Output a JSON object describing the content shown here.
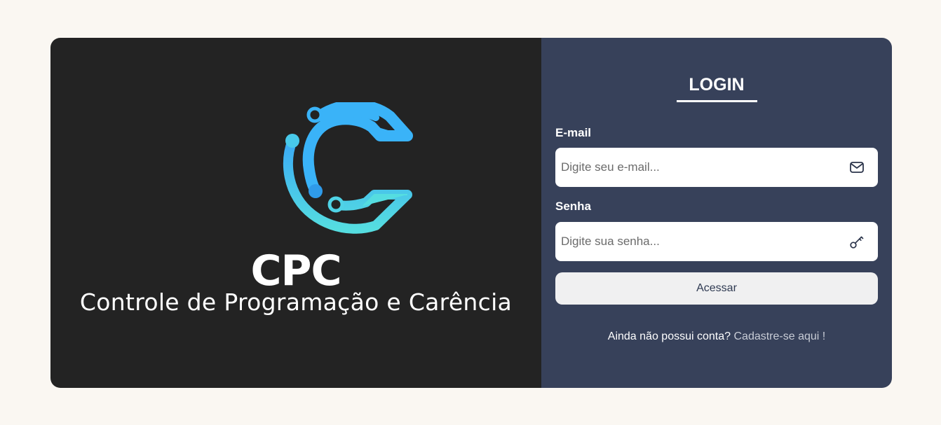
{
  "brand": {
    "acronym": "CPC",
    "subtitle": "Controle de Programação e Carência",
    "logo_icon": "cpc-circuit-c-logo",
    "colors": {
      "gradient_top": "#3aa9f5",
      "gradient_bottom": "#55dde0",
      "panel_background": "#232323"
    }
  },
  "login": {
    "title": "LOGIN",
    "email": {
      "label": "E-mail",
      "placeholder": "Digite seu e-mail...",
      "value": "",
      "icon": "envelope-icon"
    },
    "password": {
      "label": "Senha",
      "placeholder": "Digite sua senha...",
      "value": "",
      "icon": "key-icon"
    },
    "submit_label": "Acessar",
    "signup_prompt": "Ainda não possui conta?",
    "signup_link": "Cadastre-se aqui !",
    "colors": {
      "panel_background": "#37415a",
      "button_background": "#f0f0f1",
      "page_background": "#faf7f2"
    }
  }
}
